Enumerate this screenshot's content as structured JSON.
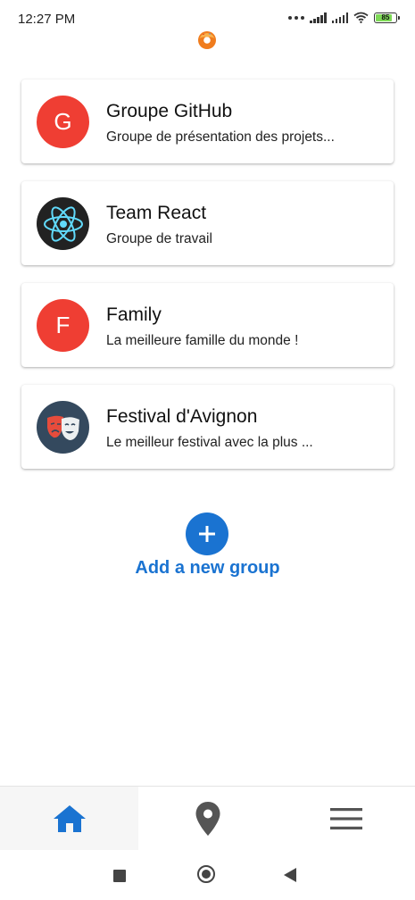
{
  "status_bar": {
    "time": "12:27 PM",
    "battery_level": "85",
    "icons": [
      "dots-icon",
      "signal-icon",
      "signal-icon",
      "wifi-icon",
      "battery-icon"
    ]
  },
  "app_logo": "donut-logo-icon",
  "groups": [
    {
      "name": "Groupe GitHub",
      "description": "Groupe de présentation des projets...",
      "avatar_letter": "G",
      "avatar_color": "#ef3e33"
    },
    {
      "name": "Team React",
      "description": "Groupe de travail",
      "avatar_icon": "react-logo-icon",
      "avatar_color": "#222222"
    },
    {
      "name": "Family",
      "description": "La meilleure famille du monde !",
      "avatar_letter": "F",
      "avatar_color": "#ef3e33"
    },
    {
      "name": "Festival d'Avignon",
      "description": "Le meilleur festival avec la plus ...",
      "avatar_icon": "theater-masks-icon",
      "avatar_color": "#34495e"
    }
  ],
  "add_group": {
    "label": "Add a new group",
    "icon": "plus-icon",
    "color": "#1a73d1"
  },
  "tabs": [
    {
      "icon": "home-icon",
      "active": true,
      "color": "#1a73d1"
    },
    {
      "icon": "map-pin-icon",
      "active": false
    },
    {
      "icon": "hamburger-menu-icon",
      "active": false
    }
  ],
  "nav_bar": [
    "recent-apps-icon",
    "home-circle-icon",
    "back-icon"
  ]
}
